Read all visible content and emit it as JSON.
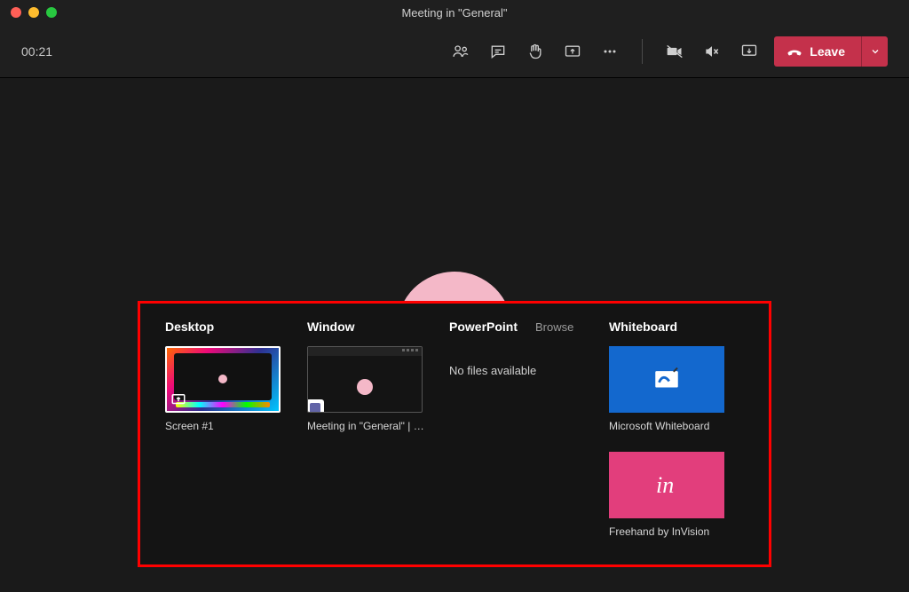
{
  "window": {
    "title": "Meeting in \"General\""
  },
  "timer": "00:21",
  "leave": {
    "label": "Leave"
  },
  "share": {
    "headers": {
      "desktop": "Desktop",
      "window": "Window",
      "powerpoint": "PowerPoint",
      "browse": "Browse",
      "whiteboard": "Whiteboard"
    },
    "desktop": {
      "items": [
        {
          "label": "Screen #1"
        }
      ]
    },
    "window": {
      "items": [
        {
          "label": "Meeting in \"General\" | M..."
        }
      ]
    },
    "powerpoint": {
      "empty_message": "No files available"
    },
    "whiteboard": {
      "items": [
        {
          "label": "Microsoft Whiteboard"
        },
        {
          "label": "Freehand by InVision"
        }
      ]
    }
  },
  "icons": {
    "people": "people-icon",
    "chat": "chat-icon",
    "hand": "raise-hand-icon",
    "share": "share-screen-icon",
    "more": "more-icon",
    "camera_off": "camera-off-icon",
    "mic_off": "speaker-off-icon",
    "dock": "dock-icon",
    "hangup": "hangup-icon"
  }
}
